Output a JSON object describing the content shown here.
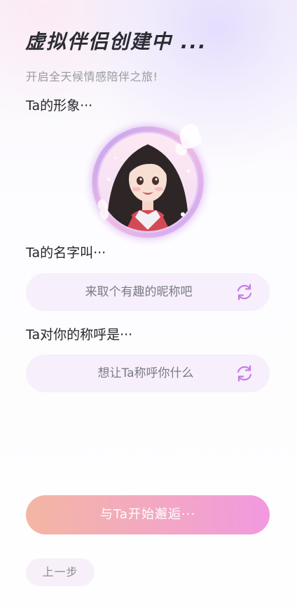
{
  "header": {
    "title": "虚拟伴侣创建中 ...",
    "subtitle": "开启全天候情感陪伴之旅!"
  },
  "avatar": {
    "label": "Ta的形象···",
    "icon": "companion-avatar-image"
  },
  "name_field": {
    "label": "Ta的名字叫···",
    "placeholder": "来取个有趣的昵称吧",
    "refresh_icon": "refresh-icon"
  },
  "nickname_field": {
    "label": "Ta对你的称呼是···",
    "placeholder": "想让Ta称呼你什么",
    "refresh_icon": "refresh-icon"
  },
  "actions": {
    "start_label": "与Ta开始邂逅···",
    "back_label": "上一步"
  },
  "colors": {
    "accent": "#c77ae6",
    "field_bg": "#f7effc",
    "button_gradient_start": "#f3b6a3",
    "button_gradient_end": "#f299e0"
  }
}
